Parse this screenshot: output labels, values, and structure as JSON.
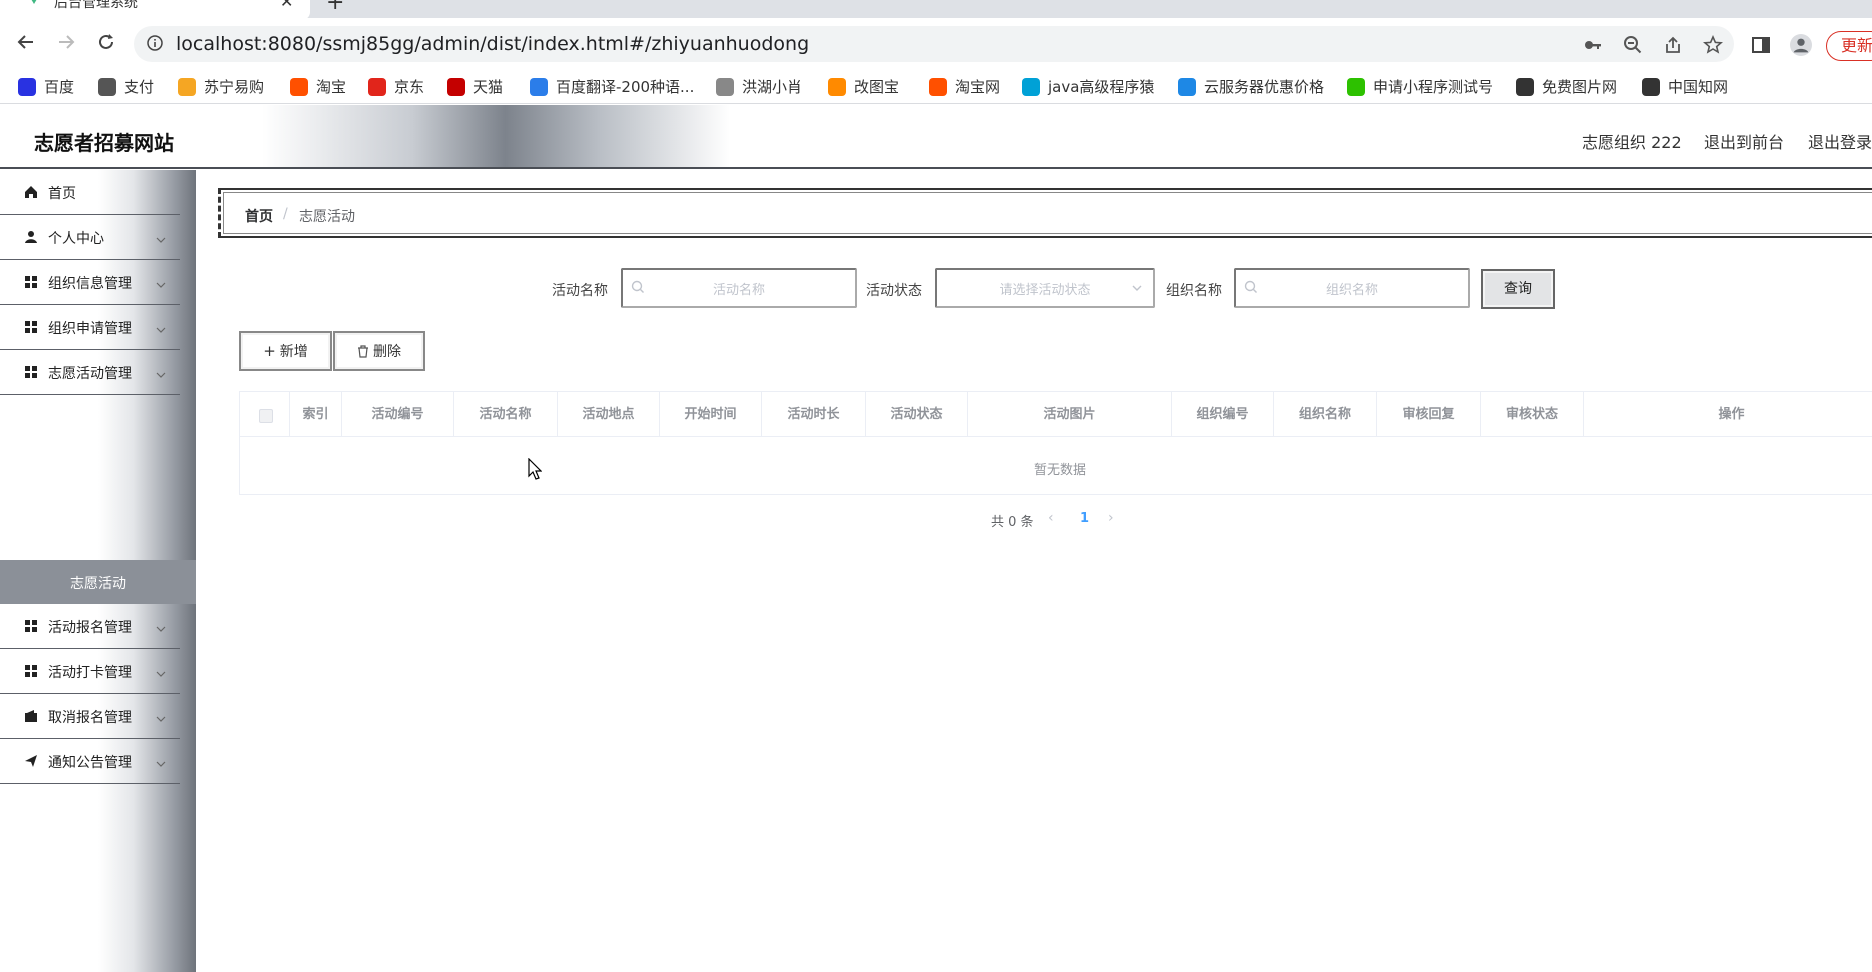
{
  "browser": {
    "tab_title": "后台管理系统",
    "url": "localhost:8080/ssmj85gg/admin/dist/index.html#/zhiyuanhuodong",
    "update_label": "更新",
    "bookmarks": [
      {
        "label": "百度",
        "icon": "baidu-icon",
        "color": "#2932e1"
      },
      {
        "label": "支付",
        "icon": "globe-icon",
        "color": "#555555"
      },
      {
        "label": "苏宁易购",
        "icon": "suning-icon",
        "color": "#f5a623"
      },
      {
        "label": "淘宝",
        "icon": "taobao-icon",
        "color": "#ff5000"
      },
      {
        "label": "京东",
        "icon": "jd-icon",
        "color": "#e1251b"
      },
      {
        "label": "天猫",
        "icon": "tmall-icon",
        "color": "#c40000"
      },
      {
        "label": "百度翻译-200种语...",
        "icon": "translate-icon",
        "color": "#2b7de9"
      },
      {
        "label": "洪湖小肖",
        "icon": "bird-icon",
        "color": "#888888"
      },
      {
        "label": "改图宝",
        "icon": "gaitubao-icon",
        "color": "#ff8a00"
      },
      {
        "label": "淘宝网",
        "icon": "taobao-icon",
        "color": "#ff5000"
      },
      {
        "label": "java高级程序猿",
        "icon": "bilibili-icon",
        "color": "#00a1d6"
      },
      {
        "label": "云服务器优惠价格",
        "icon": "cloud-icon",
        "color": "#1e88e5"
      },
      {
        "label": "申请小程序测试号",
        "icon": "wechat-icon",
        "color": "#2dc100"
      },
      {
        "label": "免费图片网",
        "icon": "t-icon",
        "color": "#333333"
      },
      {
        "label": "中国知网",
        "icon": "cnki-icon",
        "color": "#333333"
      }
    ]
  },
  "header": {
    "site_title": "志愿者招募网站",
    "user": "志愿组织 222",
    "to_front": "退出到前台",
    "logout": "退出登录"
  },
  "sidebar": {
    "items": [
      {
        "label": "首页",
        "icon": "home-icon",
        "has_children": false
      },
      {
        "label": "个人中心",
        "icon": "user-icon",
        "has_children": true
      },
      {
        "label": "组织信息管理",
        "icon": "grid-icon",
        "has_children": true
      },
      {
        "label": "组织申请管理",
        "icon": "grid-icon",
        "has_children": true
      },
      {
        "label": "志愿活动管理",
        "icon": "grid-icon",
        "has_children": true
      },
      {
        "label": "活动报名管理",
        "icon": "grid-icon",
        "has_children": true
      },
      {
        "label": "活动打卡管理",
        "icon": "grid-icon",
        "has_children": true
      },
      {
        "label": "取消报名管理",
        "icon": "wallet-icon",
        "has_children": true
      },
      {
        "label": "通知公告管理",
        "icon": "send-icon",
        "has_children": true
      }
    ],
    "active_sub": "志愿活动"
  },
  "breadcrumb": {
    "home": "首页",
    "separator": "/",
    "current": "志愿活动"
  },
  "search": {
    "name_label": "活动名称",
    "name_placeholder": "活动名称",
    "status_label": "活动状态",
    "status_placeholder": "请选择活动状态",
    "org_label": "组织名称",
    "org_placeholder": "组织名称",
    "query_label": "查询"
  },
  "actions": {
    "add": "新增",
    "delete": "删除"
  },
  "table": {
    "columns": [
      "索引",
      "活动编号",
      "活动名称",
      "活动地点",
      "开始时间",
      "活动时长",
      "活动状态",
      "活动图片",
      "组织编号",
      "组织名称",
      "审核回复",
      "审核状态",
      "操作"
    ],
    "empty_text": "暂无数据"
  },
  "pagination": {
    "total": "共 0 条",
    "current_page": "1"
  },
  "colors": {
    "accent": "#409eff",
    "sidebar_active": "#8b9098",
    "header_line": "#4a4e55"
  }
}
